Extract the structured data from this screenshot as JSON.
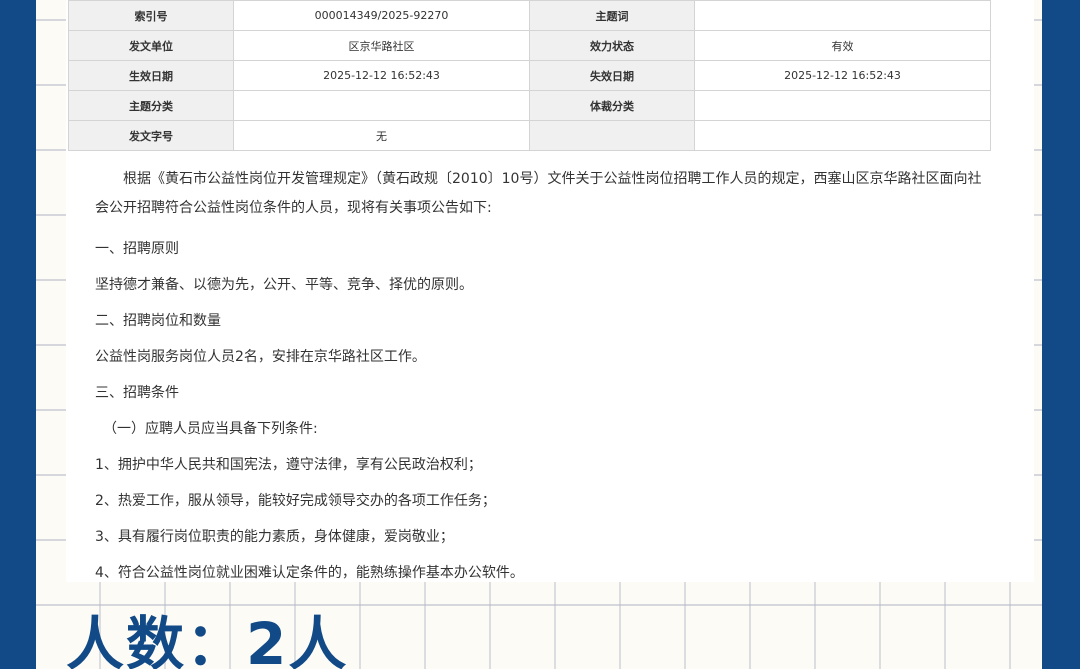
{
  "meta_table": {
    "rows": [
      {
        "l1": "索引号",
        "v1": "000014349/2025-92270",
        "l2": "主题词",
        "v2": ""
      },
      {
        "l1": "发文单位",
        "v1": "区京华路社区",
        "l2": "效力状态",
        "v2": "有效"
      },
      {
        "l1": "生效日期",
        "v1": "2025-12-12 16:52:43",
        "l2": "失效日期",
        "v2": "2025-12-12 16:52:43"
      },
      {
        "l1": "主题分类",
        "v1": "",
        "l2": "体裁分类",
        "v2": ""
      },
      {
        "l1": "发文字号",
        "v1": "无",
        "l2": "",
        "v2": ""
      }
    ]
  },
  "content": {
    "intro": "根据《黄石市公益性岗位开发管理规定》（黄石政规〔2010〕10号）文件关于公益性岗位招聘工作人员的规定，西塞山区京华路社区面向社会公开招聘符合公益性岗位条件的人员，现将有关事项公告如下:",
    "s1_title": "一、招聘原则",
    "s1_text": "坚持德才兼备、以德为先，公开、平等、竞争、择优的原则。",
    "s2_title": "二、招聘岗位和数量",
    "s2_text": "公益性岗服务岗位人员2名，安排在京华路社区工作。",
    "s3_title": "三、招聘条件",
    "s3_sub": "（一）应聘人员应当具备下列条件:",
    "items": [
      "1、拥护中华人民共和国宪法，遵守法律，享有公民政治权利；",
      "2、热爱工作，服从领导，能较好完成领导交办的各项工作任务；",
      "3、具有履行岗位职责的能力素质，身体健康，爱岗敬业；",
      "4、符合公益性岗位就业困难认定条件的，能熟练操作基本办公软件。"
    ]
  },
  "overlay": {
    "headline": "人数：2人"
  },
  "colors": {
    "frame": "#114a86",
    "paper": "#fdfbf5",
    "label_bg": "#f0f0f0"
  }
}
